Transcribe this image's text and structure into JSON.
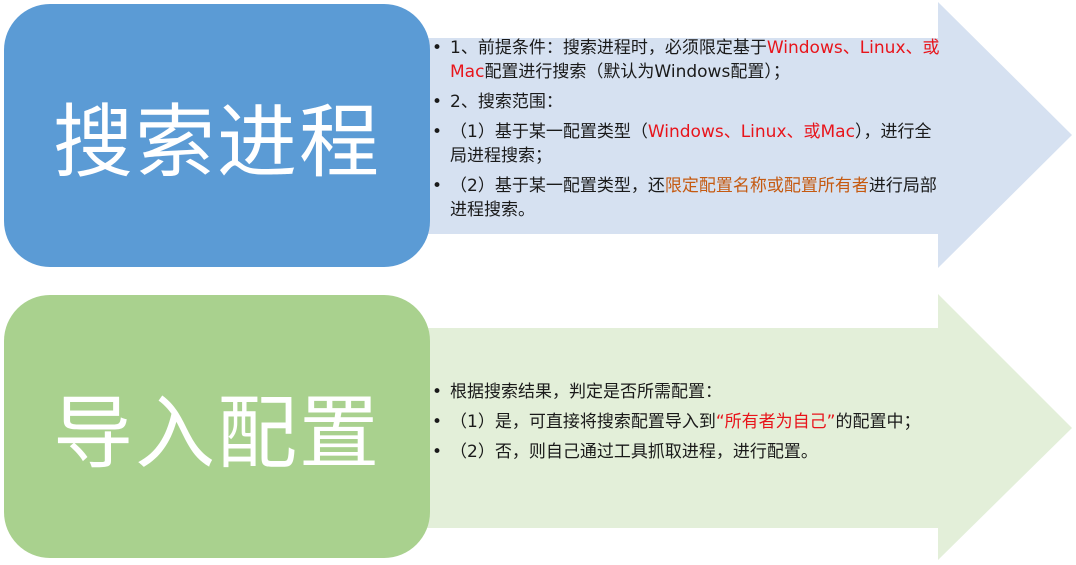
{
  "colors": {
    "blue_pill": "#5b9bd5",
    "green_pill": "#a9d18e",
    "blue_arrow": "#d6e1f1",
    "green_arrow": "#e3efd9",
    "highlight_red": "#e8141b",
    "highlight_orange": "#c55a11"
  },
  "section1": {
    "title": "搜索进程",
    "b1": {
      "pre": "1、前提条件：搜索进程时，必须限定基于",
      "red": "Windows、Linux、或Mac",
      "post": "配置进行搜索（默认为Windows配置）；"
    },
    "b2": "2、搜索范围：",
    "b3": {
      "pre": "（1）基于某一配置类型（",
      "red": "Windows、Linux、或Mac",
      "post": "），进行全局进程搜索；"
    },
    "b4": {
      "pre": "（2）基于某一配置类型，还",
      "orange": "限定配置名称或配置所有者",
      "post": "进行局部进程搜索。"
    }
  },
  "section2": {
    "title": "导入配置",
    "b1": "根据搜索结果，判定是否所需配置：",
    "b2": {
      "pre": "（1）是，可直接将搜索配置导入到",
      "red": "“所有者为自己”",
      "post": "的配置中；"
    },
    "b3": "（2）否，则自己通过工具抓取进程，进行配置。"
  }
}
